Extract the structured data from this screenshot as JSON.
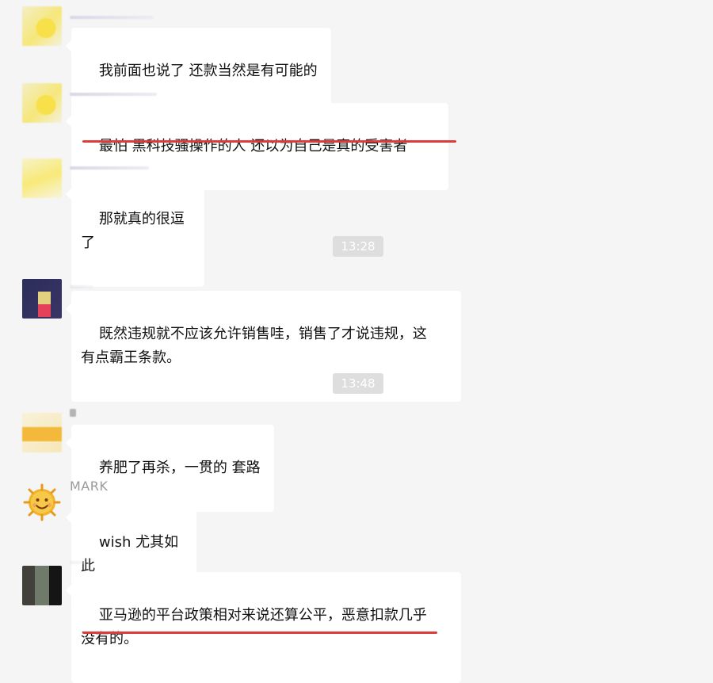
{
  "messages": [
    {
      "name": "",
      "text": "我前面也说了 还款当然是有可能的"
    },
    {
      "name": "",
      "text": "最怕 黑科技骚操作的人 还以为自己是真的受害者"
    },
    {
      "name": "",
      "text": "那就真的很逗了"
    },
    {
      "name": "",
      "text": "既然违规就不应该允许销售哇，销售了才说违规，这\n有点霸王条款。"
    },
    {
      "name": "",
      "text": "养肥了再杀，一贯的 套路"
    },
    {
      "name": "MARK",
      "text": "wish 尤其如此"
    },
    {
      "name": "",
      "text": "亚马逊的平台政策相对来说还算公平，恶意扣款几乎\n没有的。"
    }
  ],
  "timestamps": [
    "13:28",
    "13:48"
  ],
  "colors": {
    "background": "#f5f5f5",
    "bubble": "#ffffff",
    "underline": "#de3b3b",
    "timestamp_bg": "#dedede",
    "name_text": "#9a9a9a"
  },
  "icons": {
    "mark_avatar": "sun-emoji-icon"
  }
}
